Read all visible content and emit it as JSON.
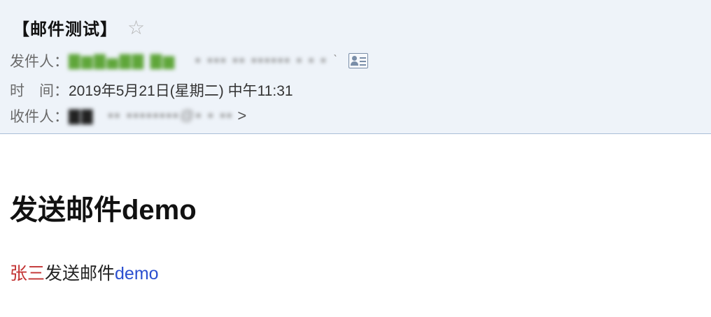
{
  "email": {
    "subject": "【邮件测试】",
    "star_icon": "star-outline-icon",
    "from": {
      "label": "发件人：",
      "name_redacted": "▇▆▇▅▇▇ ▇▆",
      "address_redacted": "▪ ▪▪▪ ▪▪ ▪▪▪▪▪▪ ▪ ▪ ▪",
      "arrow": "ˋ",
      "contact_icon": "contact-card-icon"
    },
    "time": {
      "label": "时　间：",
      "value": "2019年5月21日(星期二) 中午11:31"
    },
    "to": {
      "label": "收件人：",
      "name_redacted": "▇▇",
      "address_redacted": "▪▪ ▪▪▪▪▪▪▪▪@▪ ▪ ▪▪",
      "suffix": ">"
    }
  },
  "content": {
    "heading": "发送邮件demo",
    "line": {
      "part_red": "张三",
      "part_black": "发送邮件",
      "part_blue": "demo"
    }
  },
  "colors": {
    "header_bg": "#eef3f9",
    "header_border": "#a9bfd8",
    "red": "#c23131",
    "blue": "#2b4fd0"
  }
}
